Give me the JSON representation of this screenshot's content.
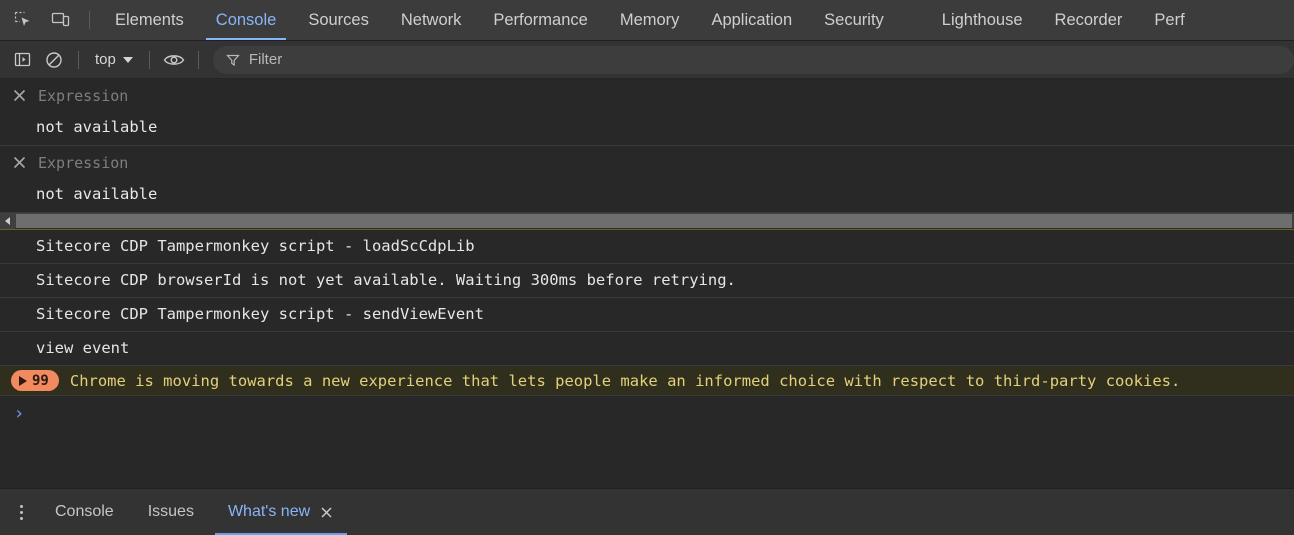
{
  "panel_tabs": {
    "inspect_icon": "inspect-element-icon",
    "device_icon": "device-toolbar-icon",
    "items": [
      {
        "label": "Elements",
        "active": false
      },
      {
        "label": "Console",
        "active": true
      },
      {
        "label": "Sources",
        "active": false
      },
      {
        "label": "Network",
        "active": false
      },
      {
        "label": "Performance",
        "active": false
      },
      {
        "label": "Memory",
        "active": false
      },
      {
        "label": "Application",
        "active": false
      },
      {
        "label": "Security",
        "active": false
      }
    ],
    "items_overflow": [
      {
        "label": "Lighthouse",
        "active": false
      },
      {
        "label": "Recorder",
        "active": false
      },
      {
        "label": "Perf",
        "active": false
      }
    ]
  },
  "toolbar": {
    "sidebar_toggle_icon": "console-sidebar-icon",
    "clear_console_icon": "clear-console-icon",
    "context_value": "top",
    "eye_icon": "live-expression-eye-icon",
    "filter_icon": "filter-funnel-icon",
    "filter_placeholder": "Filter",
    "filter_value": ""
  },
  "console": {
    "live_expressions": [
      {
        "close_icon": "close-icon",
        "name": "Expression",
        "value": "not available"
      },
      {
        "close_icon": "close-icon",
        "name": "Expression",
        "value": "not available"
      }
    ],
    "scrollbar": {
      "left_arrow_icon": "scroll-left-arrow-icon"
    },
    "messages": [
      {
        "type": "log",
        "text": "Sitecore CDP Tampermonkey script - loadScCdpLib"
      },
      {
        "type": "log",
        "text": "Sitecore CDP browserId is not yet available. Waiting 300ms before retrying."
      },
      {
        "type": "log",
        "text": "Sitecore CDP Tampermonkey script - sendViewEvent"
      },
      {
        "type": "log",
        "text": "view event"
      }
    ],
    "warning": {
      "expand_icon": "expand-triangle-icon",
      "count": "99",
      "text": "Chrome is moving towards a new experience that lets people make an informed choice with respect to third-party cookies.",
      "badge_color": "#f2895f",
      "text_color": "#e4d07a",
      "background_color": "#302f1e"
    },
    "prompt": {
      "caret": "›",
      "value": ""
    }
  },
  "drawer": {
    "menu_icon": "more-options-kebab-icon",
    "tabs": [
      {
        "label": "Console",
        "active": false,
        "closable": false
      },
      {
        "label": "Issues",
        "active": false,
        "closable": false
      },
      {
        "label": "What's new",
        "active": true,
        "closable": true,
        "close_icon": "close-icon"
      }
    ]
  },
  "theme": {
    "accent": "#8ab4f8",
    "background": "#282828",
    "toolbar_background": "#333333",
    "tabbar_background": "#3c3c3c"
  }
}
